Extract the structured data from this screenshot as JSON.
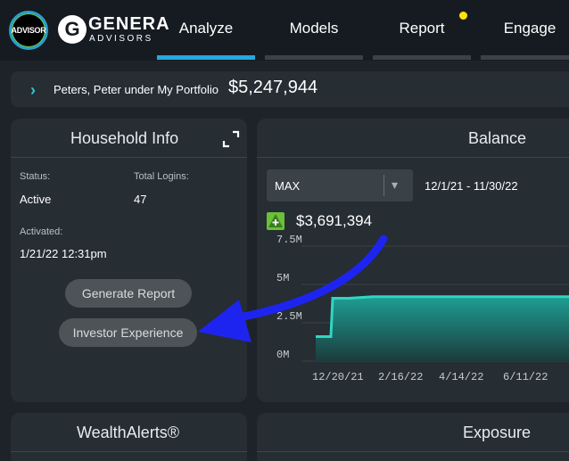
{
  "nav": {
    "advisor_badge": "ADVISOR",
    "brand_letter": "G",
    "brand_name": "GENERA",
    "brand_sub": "ADVISORS",
    "tabs": [
      {
        "label": "Analyze",
        "active": true
      },
      {
        "label": "Models",
        "active": false
      },
      {
        "label": "Report",
        "active": false,
        "notification": true
      },
      {
        "label": "Engage",
        "active": false
      }
    ],
    "accent": "#25a8e0",
    "notification_color": "#ffe500"
  },
  "portfolio": {
    "label": "Peters, Peter under My Portfolio",
    "value": "$5,247,944"
  },
  "household": {
    "title": "Household Info",
    "status_label": "Status:",
    "status_value": "Active",
    "logins_label": "Total Logins:",
    "logins_value": "47",
    "activated_label": "Activated:",
    "activated_value": "1/21/22 12:31pm",
    "generate_button": "Generate Report",
    "investor_button": "Investor Experience"
  },
  "balance": {
    "title": "Balance",
    "range_select": "MAX",
    "date_range": "12/1/21 - 11/30/22",
    "current_value": "$3,691,394",
    "trend_icon": "plus-up-icon"
  },
  "wealthalerts": {
    "title": "WealthAlerts®"
  },
  "exposure": {
    "title": "Exposure"
  },
  "chart_data": {
    "type": "area",
    "x": [
      "12/1/21",
      "12/20/21",
      "12/27/21",
      "1/3/22",
      "1/21/22",
      "2/16/22",
      "4/14/22",
      "6/11/22",
      "7/1/22"
    ],
    "values": [
      1.6,
      1.6,
      4.1,
      4.1,
      4.2,
      4.2,
      4.2,
      4.2,
      4.2
    ],
    "x_tick_labels": [
      "12/20/21",
      "2/16/22",
      "4/14/22",
      "6/11/22"
    ],
    "y_tick_labels": [
      "7.5M",
      "5M",
      "2.5M",
      "0M"
    ],
    "y_ticks": [
      7.5,
      5,
      2.5,
      0
    ],
    "ylim": [
      0,
      7.5
    ],
    "color": "#2fd6c4",
    "grid": true
  }
}
